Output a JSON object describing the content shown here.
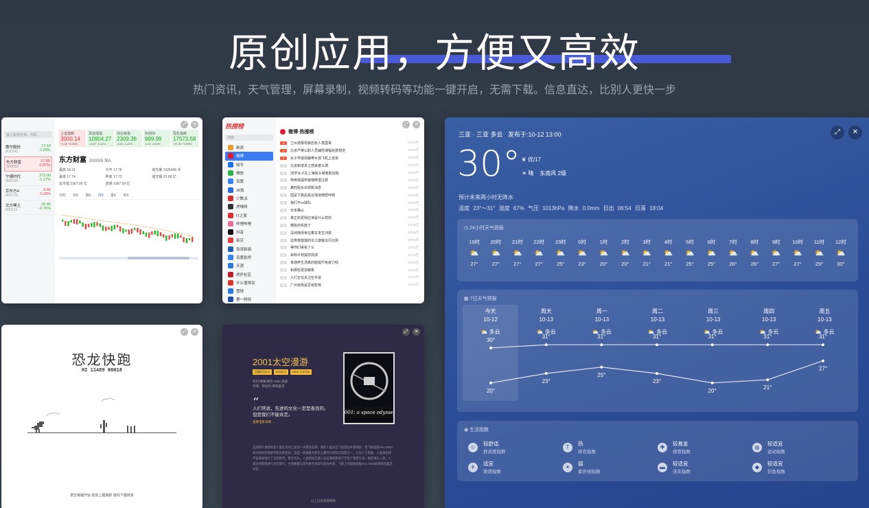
{
  "hero": {
    "title": "原创应用，方便又高效",
    "subtitle": "热门资讯，天气管理，屏幕录制，视频转码等功能一键开启，无需下载。信息直达，比别人更快一步"
  },
  "stock": {
    "search_placeholder": "输入股票名称、代码",
    "watch": [
      {
        "name": "歌尔股份",
        "code": "002241",
        "price": "17.63",
        "change": "-1.03%",
        "down": true
      },
      {
        "name": "东方财富",
        "code": "300059",
        "price": "17.90",
        "change": "0.97%",
        "down": false
      },
      {
        "name": "宁德时代",
        "code": "300750",
        "price": "373.00",
        "change": "-1.17%",
        "down": true
      },
      {
        "name": "京东方A",
        "code": "000725",
        "price": "3.56",
        "change": "0.28%",
        "down": false
      },
      {
        "name": "北方稀土",
        "code": "600111",
        "price": "25.45",
        "change": "-0.76%",
        "down": true
      }
    ],
    "indices": [
      {
        "name": "上证指数",
        "value": "3000.14",
        "delta": "+1.33 +0.04%",
        "up": true
      },
      {
        "name": "深证成指",
        "value": "10904.27",
        "delta": "-13.57 -0.12%",
        "up": false
      },
      {
        "name": "创业板指",
        "value": "2309.36",
        "delta": "-5.00 -0.22%",
        "up": false
      },
      {
        "name": "科创50",
        "value": "999.99",
        "delta": "-0.37 -0.04%",
        "up": false
      },
      {
        "name": "恒生指数",
        "value": "17573.58",
        "delta": "+97.23 +0.55%",
        "up": false
      }
    ],
    "name": "东方财富",
    "code": "300059 深A",
    "fields": [
      "最高 18.21",
      "今开 17.76",
      "成交量 1325645 手",
      "最低 17.74",
      "昨收 17.73",
      "成交额 23.68 亿",
      "总市值 2367.06 亿",
      "流通 1967.09 亿",
      ""
    ],
    "tabs": [
      "分时",
      "日K",
      "周K",
      "月K",
      "季K",
      "年K"
    ],
    "active_tab": "月K"
  },
  "hotlist": {
    "logo": "热搜榜",
    "search_placeholder": "搜索",
    "nav": [
      {
        "label": "新浪",
        "color": "#f09b2a"
      },
      {
        "label": "微博",
        "color": "#e6162d"
      },
      {
        "label": "知乎",
        "color": "#1772f6"
      },
      {
        "label": "微信",
        "color": "#2cb54a"
      },
      {
        "label": "百度",
        "color": "#3385ff"
      },
      {
        "label": "36氪",
        "color": "#2a6ae9"
      },
      {
        "label": "少数派",
        "color": "#d92d2d"
      },
      {
        "label": "虎嗅网",
        "color": "#333333"
      },
      {
        "label": "IT之家",
        "color": "#d63232"
      },
      {
        "label": "哔哩哔哩",
        "color": "#ee6e9b"
      },
      {
        "label": "抖音",
        "color": "#111111"
      },
      {
        "label": "新京",
        "color": "#e43a3a"
      },
      {
        "label": "澎湃新闻",
        "color": "#1f5fb4"
      },
      {
        "label": "百度贴吧",
        "color": "#3385ff"
      },
      {
        "label": "天涯",
        "color": "#2d7adf"
      },
      {
        "label": "虎扑社区",
        "color": "#c01d2f"
      },
      {
        "label": "什么值得买",
        "color": "#e3342f"
      },
      {
        "label": "雪球",
        "color": "#2a7be0"
      },
      {
        "label": "第一财经",
        "color": "#1c4fa0"
      }
    ],
    "active": "微博",
    "title": "微博·热搜榜",
    "items": [
      "兰州通报母婴店杖人意国事",
      "北京严禁公职人员辅导课程收费规范",
      "女子怀疑拐骗带女孩飞机上逃单",
      "北京新增本土感染者11例",
      "38岁女子在上海街头被救助出院",
      "称用保温杯装咖啡需注意",
      "鑫旺股东出现新消息",
      "国足下跌后看台球迷愤怒呼喊",
      "我们不vs球队",
      "日本确认",
      "真正的爱情应该是什么样的",
      "哪些的实施了",
      "深圳随母亲在乘车发生冲突",
      "这类慢悠悠的长江游客出行比例",
      "等你们来看了么",
      "目标计划提前完成",
      "普通养生汤真的能提升免疫力吗",
      "和那些更加疲惫",
      "人们正在关注空手道",
      "广州抢购是否有影响"
    ],
    "count": "170.6万"
  },
  "dino": {
    "title": "恐龙快跑",
    "score": "HI 11489  00018",
    "footer": "按空格键开始  按向上键跳跃  按向下键俯身"
  },
  "movie": {
    "title": "2001太空漫游",
    "tags": [
      "豆瓣评分8.8",
      "IMDb8.3",
      "IMDb TOP250"
    ],
    "meta": "科幻/惊悚/冒险 1968 美国",
    "director": "导演：斯坦利·库布里克",
    "quote_mark": "“",
    "quote_lines": [
      "人们常说，先进的文化一定是善良的。",
      "但是我们不能肯定。"
    ],
    "link": "查看电影详情 →",
    "body": "这部影片讲述的是人类在月球上发现一块黑色石碑，随后人类派出飞船前往木星探索，但飞船电脑HAL 9000却开始失控威胁宇航员的生命。这是一部被誉为影史上最伟大的科幻电影之一，它对人工智能、人类演化和宇宙奥秘进行了深刻思考。影片开头，人类的祖先猿人在石碑的影响下学会了使用工具，随后镜头一转，人类已经能够进行太空旅行。主角鲍曼与普尔乘坐发现号前往木星，飞船上的超级电脑HAL 9000却逐渐显露出异常...",
    "footer": "以上信息来源网络"
  },
  "weather": {
    "location": "三亚 · 三亚  多云",
    "publish": "发布于:10-12 13:00",
    "temp": "30°",
    "aqi": "优/17",
    "condition": "晴",
    "wind": "东南风 2级",
    "rain": "预计未来两小时无降水",
    "details": "温度 23°～31°  湿度 67%  气压 1013hPa  降水 0.0mm  日出 06:54  日落 18:04",
    "hourly_title": "24小时天气预报",
    "hourly": [
      {
        "t": "19时",
        "v": "27°"
      },
      {
        "t": "20时",
        "v": "27°"
      },
      {
        "t": "21时",
        "v": "27°"
      },
      {
        "t": "22时",
        "v": "27°"
      },
      {
        "t": "23时",
        "v": "25°"
      },
      {
        "t": "0时",
        "v": "23°"
      },
      {
        "t": "1时",
        "v": "20°"
      },
      {
        "t": "2时",
        "v": "20°"
      },
      {
        "t": "3时",
        "v": "21°"
      },
      {
        "t": "4时",
        "v": "21°"
      },
      {
        "t": "5时",
        "v": "25°"
      },
      {
        "t": "6时",
        "v": "25°"
      },
      {
        "t": "7时",
        "v": "26°"
      },
      {
        "t": "8时",
        "v": "26°"
      },
      {
        "t": "9时",
        "v": "27°"
      },
      {
        "t": "10时",
        "v": "27°"
      },
      {
        "t": "11时",
        "v": "29°"
      },
      {
        "t": "12时",
        "v": "30°"
      }
    ],
    "daily_title": "7日天气预报",
    "daily": [
      {
        "day": "今天",
        "date": "10-12",
        "cond": "多云",
        "hi": 30,
        "lo": 20
      },
      {
        "day": "周天",
        "date": "10-13",
        "cond": "多云",
        "hi": 31,
        "lo": 23
      },
      {
        "day": "周一",
        "date": "10-13",
        "cond": "多云",
        "hi": 31,
        "lo": 25
      },
      {
        "day": "周二",
        "date": "10-13",
        "cond": "多云",
        "hi": 31,
        "lo": 23
      },
      {
        "day": "周三",
        "date": "10-13",
        "cond": "多云",
        "hi": 31,
        "lo": 20
      },
      {
        "day": "周四",
        "date": "10-13",
        "cond": "多云",
        "hi": 31,
        "lo": 21
      },
      {
        "day": "周五",
        "date": "10-13",
        "cond": "多云",
        "hi": 31,
        "lo": 27
      }
    ],
    "life_title": "生活指数",
    "life": [
      {
        "v": "较舒适",
        "k": "舒适度指数",
        "icon": "smile-icon",
        "glyph": "☺"
      },
      {
        "v": "热",
        "k": "穿衣指数",
        "icon": "shirt-icon",
        "glyph": "T"
      },
      {
        "v": "较易发",
        "k": "感冒指数",
        "icon": "pill-icon",
        "glyph": "✚"
      },
      {
        "v": "较适宜",
        "k": "运动指数",
        "icon": "ball-icon",
        "glyph": "◍"
      },
      {
        "v": "适宜",
        "k": "旅游指数",
        "icon": "plane-icon",
        "glyph": "✈"
      },
      {
        "v": "弱",
        "k": "紫外线指数",
        "icon": "sun-icon",
        "glyph": "☀"
      },
      {
        "v": "较适宜",
        "k": "洗车指数",
        "icon": "car-icon",
        "glyph": "▬"
      },
      {
        "v": "较适宜",
        "k": "钓鱼指数",
        "icon": "fish-icon",
        "glyph": "◆"
      }
    ]
  }
}
